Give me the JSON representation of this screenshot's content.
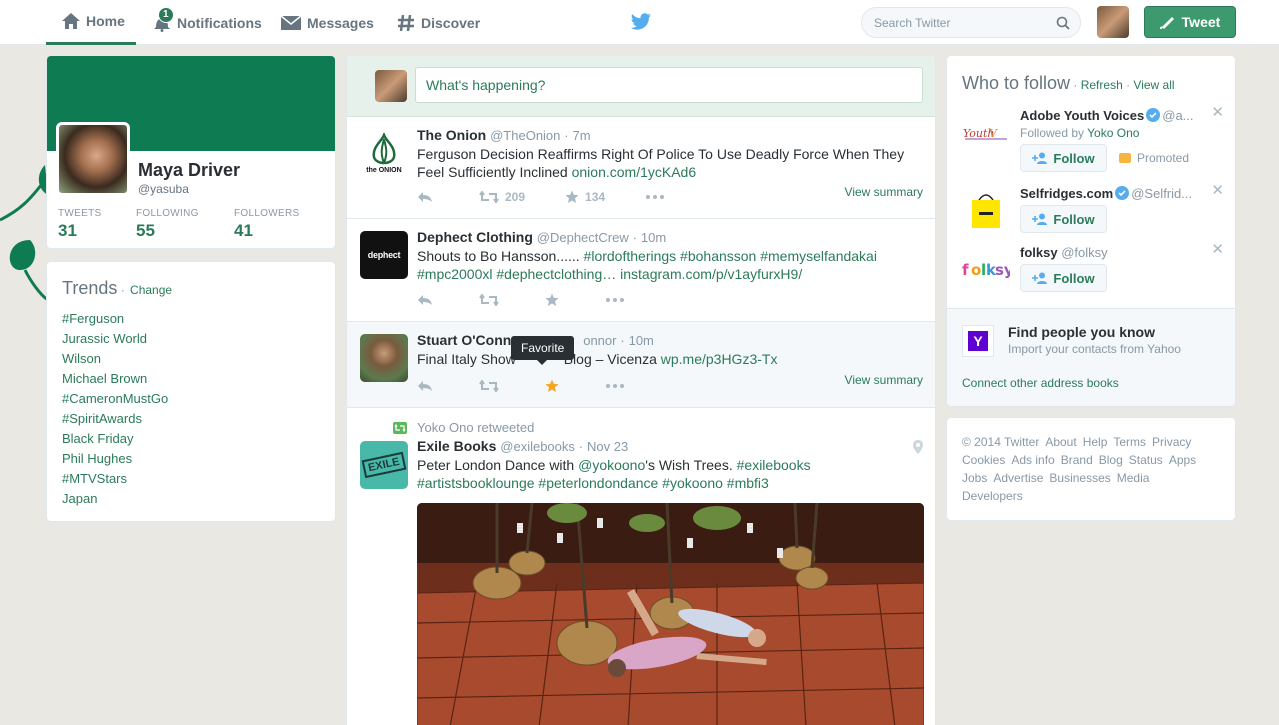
{
  "nav": {
    "home": "Home",
    "notifications": "Notifications",
    "notifications_count": "1",
    "messages": "Messages",
    "discover": "Discover",
    "search_placeholder": "Search Twitter",
    "tweet_button": "Tweet"
  },
  "profile": {
    "name": "Maya Driver",
    "handle": "@yasuba",
    "stats": [
      {
        "label": "TWEETS",
        "value": "31"
      },
      {
        "label": "FOLLOWING",
        "value": "55"
      },
      {
        "label": "FOLLOWERS",
        "value": "41"
      }
    ]
  },
  "trends": {
    "title": "Trends",
    "change": "Change",
    "items": [
      "#Ferguson",
      "Jurassic World",
      "Wilson",
      "Michael Brown",
      "#CameronMustGo",
      "#SpiritAwards",
      "Black Friday",
      "Phil Hughes",
      "#MTVStars",
      "Japan"
    ]
  },
  "composer": {
    "placeholder": "What's happening?"
  },
  "tweets": [
    {
      "name": "The Onion",
      "handle": "@TheOnion",
      "time": "7m",
      "text": "Ferguson Decision Reaffirms Right Of Police To Use Deadly Force When They Feel Sufficiently Inclined ",
      "link": "onion.com/1ycKAd6",
      "retweets": "209",
      "favorites": "134",
      "view_summary": "View summary",
      "avatar_label": "the ONION"
    },
    {
      "name": "Dephect Clothing",
      "handle": "@DephectCrew",
      "time": "10m",
      "text_plain": "Shouts to Bo Hansson...... ",
      "hashtags_line1": "#lordoftherings #bohansson #memyselfandakai",
      "hashtags_line2": "#mpc2000xl #dephectclothing… ",
      "link": "instagram.com/p/v1ayfurxH9/",
      "avatar_label": "dephect"
    },
    {
      "name": "Stuart O'Conn",
      "handle_partial": "onnor",
      "time": "10m",
      "text": "Final Italy Show ",
      "text_after_tooltip": "Blog – Vicenza ",
      "link": "wp.me/p3HGz3-Tx",
      "tooltip": "Favorite",
      "view_summary": "View summary"
    },
    {
      "retweeted_by": "Yoko Ono retweeted",
      "name": "Exile Books",
      "handle": "@exilebooks",
      "time": "Nov 23",
      "text": "Peter London Dance with ",
      "mention": "@yokoono",
      "text2": "'s Wish Trees. ",
      "hashtag1": "#exilebooks",
      "hashtags_line2": "#artistsbooklounge #peterlondondance #yokoono #mbfi3",
      "avatar_label": "EXILE"
    }
  ],
  "who_to_follow": {
    "title": "Who to follow",
    "refresh": "Refresh",
    "view_all": "View all",
    "follow_label": "Follow",
    "suggestions": [
      {
        "name": "Adobe Youth Voices",
        "handle": "@a...",
        "sub_prefix": "Followed by ",
        "sub_name": "Yoko Ono",
        "promoted": "Promoted"
      },
      {
        "name": "Selfridges.com",
        "handle": "@Selfrid..."
      },
      {
        "name": "folksy",
        "handle": "@folksy"
      }
    ],
    "find_people_title": "Find people you know",
    "find_people_sub": "Import your contacts from Yahoo",
    "connect_link": "Connect other address books"
  },
  "footer": {
    "links": [
      "© 2014 Twitter",
      "About",
      "Help",
      "Terms",
      "Privacy",
      "Cookies",
      "Ads info",
      "Brand",
      "Blog",
      "Status",
      "Apps",
      "Jobs",
      "Advertise",
      "Businesses",
      "Media",
      "Developers"
    ]
  },
  "colors": {
    "accent": "#2b7b5a",
    "banner": "#0f7b53",
    "tweet_button": "#3d9a6e"
  }
}
